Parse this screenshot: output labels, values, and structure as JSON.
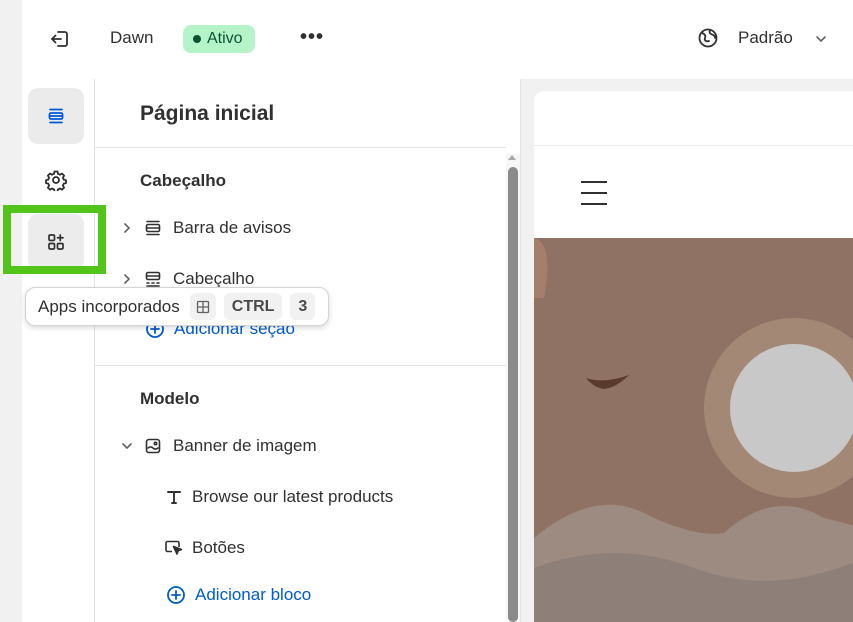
{
  "topbar": {
    "theme_name": "Dawn",
    "status": "Ativo",
    "more": "•••",
    "language": "Padrão"
  },
  "rail": {
    "items": [
      {
        "icon": "sections-icon",
        "active": true
      },
      {
        "icon": "gear-icon",
        "active": false
      },
      {
        "icon": "apps-add-icon",
        "active": false
      }
    ]
  },
  "panel": {
    "title": "Página inicial",
    "header_group": {
      "label": "Cabeçalho",
      "items": [
        {
          "label": "Barra de avisos",
          "icon": "announcement-bar-icon"
        },
        {
          "label": "Cabeçalho",
          "icon": "header-section-icon"
        }
      ],
      "add_section": "Adicionar seção"
    },
    "template_group": {
      "label": "Modelo",
      "section": {
        "label": "Banner de imagem",
        "icon": "image-banner-icon"
      },
      "blocks": [
        {
          "label": "Browse our latest products",
          "icon": "text-icon"
        },
        {
          "label": "Botões",
          "icon": "button-cursor-icon"
        }
      ],
      "add_block": "Adicionar bloco"
    }
  },
  "tooltip": {
    "label": "Apps incorporados",
    "keys": [
      "CTRL",
      "3"
    ]
  },
  "colors": {
    "accent_link": "#005bd3",
    "status_bg": "#b4f4c8",
    "status_text": "#0c5132",
    "highlight": "#52c41a",
    "banner_bg": "#8f7263"
  }
}
